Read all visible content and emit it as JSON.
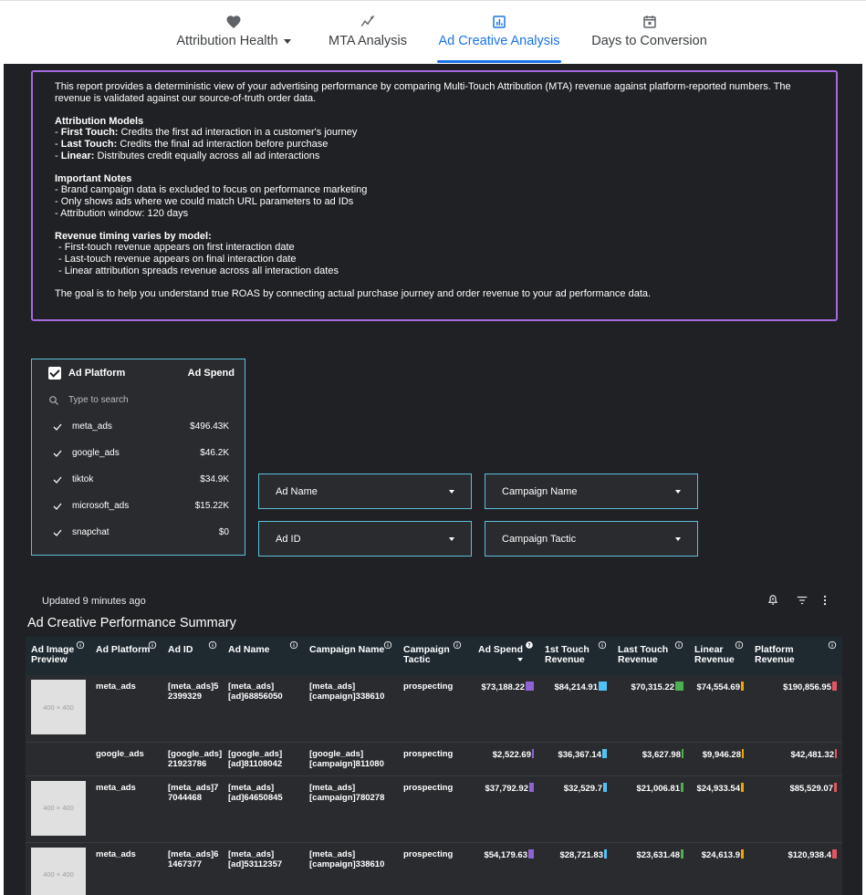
{
  "nav": {
    "tabs": [
      {
        "label": "Attribution Health",
        "icon": "heart-icon"
      },
      {
        "label": "MTA Analysis",
        "icon": "insights-icon"
      },
      {
        "label": "Ad Creative Analysis",
        "icon": "bar-chart-icon"
      },
      {
        "label": "Days to Conversion",
        "icon": "calendar-icon"
      }
    ],
    "active": "Ad Creative Analysis",
    "accent": "#1a73e8"
  },
  "info": {
    "intro": "This report provides a deterministic view of your advertising performance by comparing Multi-Touch Attribution (MTA) revenue against platform-reported numbers. The revenue is validated against our source-of-truth order data.",
    "models_heading": "Attribution Models",
    "models": [
      {
        "name": "First Touch:",
        "desc": "Credits the first ad interaction in a customer's journey"
      },
      {
        "name": "Last Touch:",
        "desc": "Credits the final ad interaction before purchase"
      },
      {
        "name": "Linear:",
        "desc": "Distributes credit equally across all ad interactions"
      }
    ],
    "notes_heading": "Important Notes",
    "notes": [
      "- Brand campaign data is excluded to focus on performance marketing",
      "- Only shows ads where we could match URL parameters to ad IDs",
      "- Attribution window: 120 days"
    ],
    "timing_heading": "Revenue timing varies by model:",
    "timing": [
      "- First-touch revenue appears on first interaction date",
      "- Last-touch revenue appears on final interaction date",
      "- Linear attribution spreads revenue across all interaction dates"
    ],
    "goal": "The goal is to help you understand true ROAS by connecting actual purchase journey and order revenue to your ad performance data.",
    "border_color": "#a56ae0"
  },
  "platform_filter": {
    "header_label": "Ad Platform",
    "header_spend": "Ad Spend",
    "search_placeholder": "Type to search",
    "items": [
      {
        "name": "meta_ads",
        "spend": "$496.43K"
      },
      {
        "name": "google_ads",
        "spend": "$46.2K"
      },
      {
        "name": "tiktok",
        "spend": "$34.9K"
      },
      {
        "name": "microsoft_ads",
        "spend": "$15.22K"
      },
      {
        "name": "snapchat",
        "spend": "$0"
      }
    ],
    "border_color": "#5bc0de"
  },
  "filters": {
    "ad_name": "Ad Name",
    "campaign_name": "Campaign Name",
    "ad_id": "Ad ID",
    "campaign_tactic": "Campaign Tactic"
  },
  "status": {
    "updated": "Updated 9 minutes ago"
  },
  "table": {
    "title": "Ad Creative Performance Summary",
    "columns": {
      "preview": "Ad Image Preview",
      "platform": "Ad Platform",
      "ad_id": "Ad ID",
      "ad_name": "Ad Name",
      "campaign_name": "Campaign Name",
      "campaign_tactic": "Campaign Tactic",
      "ad_spend": "Ad Spend",
      "first_touch": "1st Touch Revenue",
      "last_touch": "Last Touch Revenue",
      "linear": "Linear Revenue",
      "platform_revenue": "Platform Revenue"
    },
    "bar_colors": {
      "ad_spend": "#8e63d6",
      "first_touch": "#4fc3f7",
      "last_touch": "#4caf50",
      "linear": "#f0a500",
      "platform_revenue": "#e25563"
    },
    "thumb_label": "400 × 400",
    "rows": [
      {
        "has_preview": true,
        "platform": "meta_ads",
        "ad_id": "[meta_ads]5 2399329",
        "ad_name": "[meta_ads] [ad]68856050",
        "campaign_name": "[meta_ads] [campaign]338610",
        "campaign_tactic": "prospecting",
        "ad_spend": "$73,188.22",
        "first_touch": "$84,214.91",
        "last_touch": "$70,315.22",
        "linear": "$74,554.69",
        "platform_revenue": "$190,856.95",
        "bars": {
          "ad_spend": 1.0,
          "first_touch": 1.0,
          "last_touch": 1.0,
          "linear": 0.3,
          "platform_revenue": 0.5
        }
      },
      {
        "has_preview": false,
        "platform": "google_ads",
        "ad_id": "[google_ads] 21923786",
        "ad_name": "[google_ads] [ad]81108042",
        "campaign_name": "[google_ads] [campaign]811080",
        "campaign_tactic": "prospecting",
        "ad_spend": "$2,522.69",
        "first_touch": "$36,367.14",
        "last_touch": "$3,627.98",
        "linear": "$9,946.28",
        "platform_revenue": "$42,481.32",
        "bars": {
          "ad_spend": 0.2,
          "first_touch": 0.5,
          "last_touch": 0.2,
          "linear": 0.2,
          "platform_revenue": 0.2
        }
      },
      {
        "has_preview": true,
        "platform": "meta_ads",
        "ad_id": "[meta_ads]7 7044468",
        "ad_name": "[meta_ads] [ad]64650845",
        "campaign_name": "[meta_ads] [campaign]780278",
        "campaign_tactic": "prospecting",
        "ad_spend": "$37,792.92",
        "first_touch": "$32,529.7",
        "last_touch": "$21,006.81",
        "linear": "$24,933.54",
        "platform_revenue": "$85,529.07",
        "bars": {
          "ad_spend": 0.5,
          "first_touch": 0.4,
          "last_touch": 0.3,
          "linear": 0.3,
          "platform_revenue": 0.3
        }
      },
      {
        "has_preview": true,
        "platform": "meta_ads",
        "ad_id": "[meta_ads]6 1467377",
        "ad_name": "[meta_ads] [ad]53112357",
        "campaign_name": "[meta_ads] [campaign]338610",
        "campaign_tactic": "prospecting",
        "ad_spend": "$54,179.63",
        "first_touch": "$28,721.83",
        "last_touch": "$23,631.48",
        "linear": "$24,613.9",
        "platform_revenue": "$120,938.4",
        "bars": {
          "ad_spend": 0.7,
          "first_touch": 0.35,
          "last_touch": 0.3,
          "linear": 0.3,
          "platform_revenue": 0.6
        }
      }
    ]
  }
}
